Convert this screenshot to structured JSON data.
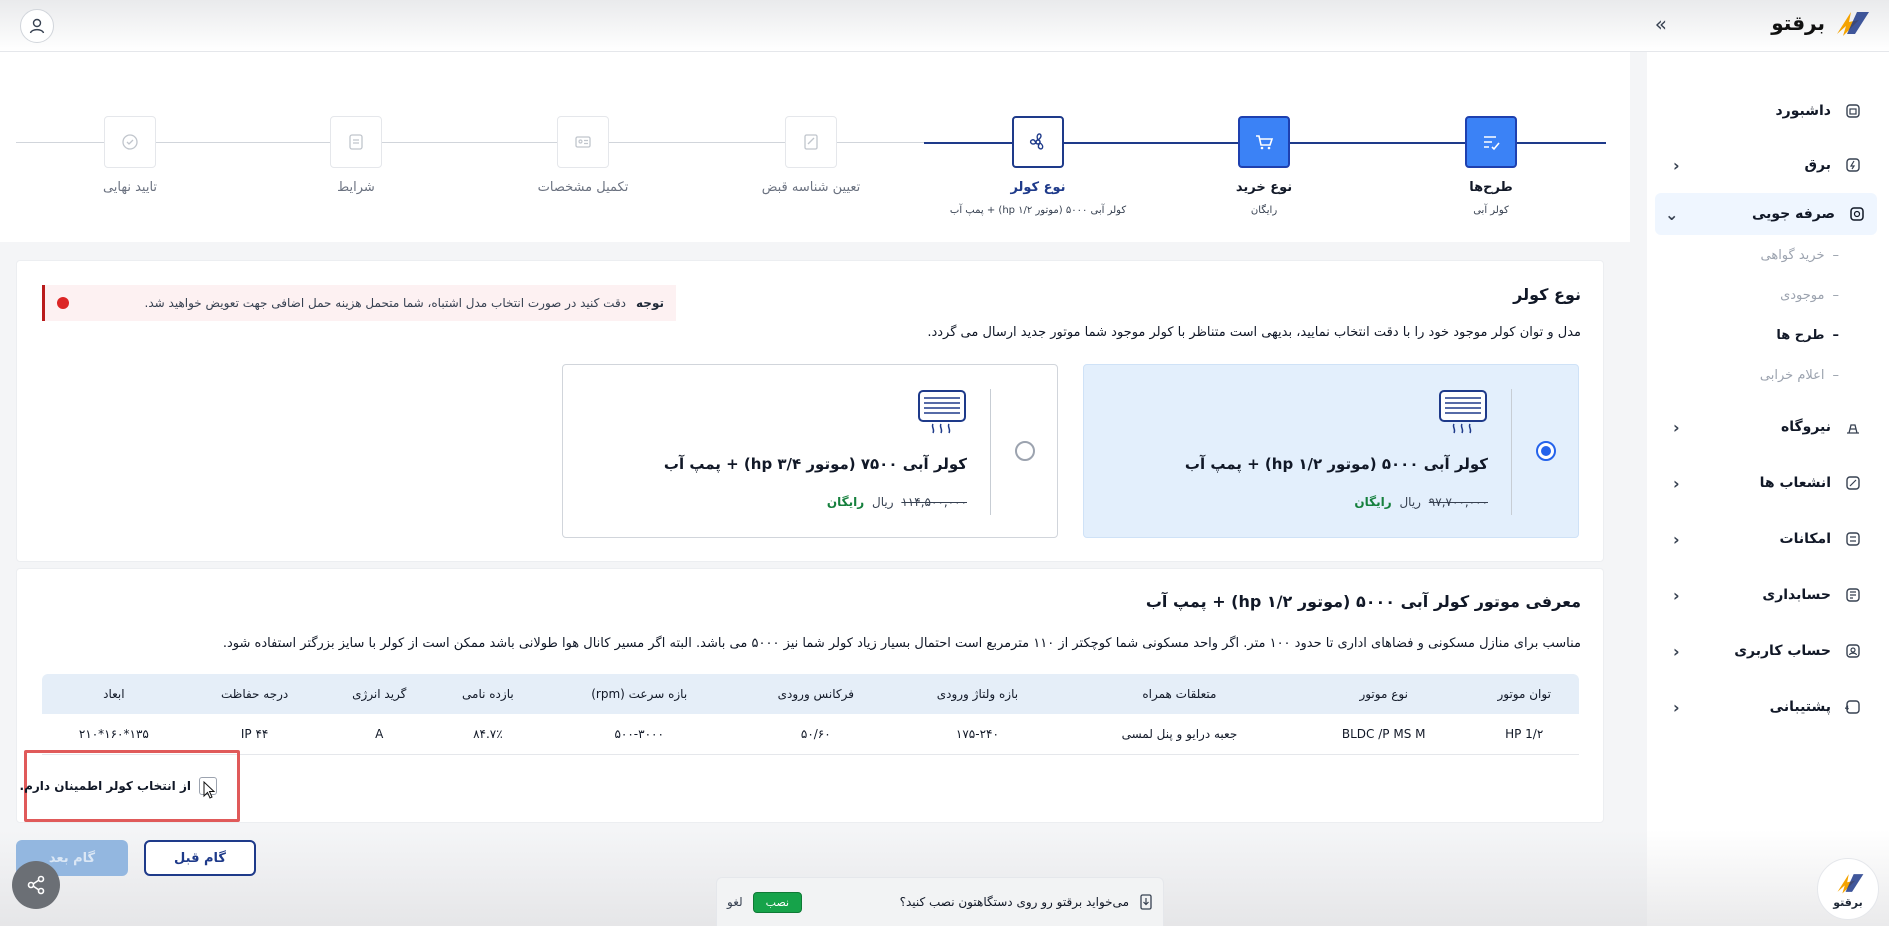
{
  "app": {
    "brand": "برقتو"
  },
  "sidebar": {
    "items": [
      {
        "label": "داشبورد",
        "icon": "dashboard-icon"
      },
      {
        "label": "برق",
        "icon": "electricity-icon"
      },
      {
        "label": "صرفه جویی",
        "icon": "savings-icon"
      },
      {
        "label": "نیروگاه",
        "icon": "power-plant-icon"
      },
      {
        "label": "انشعاب ها",
        "icon": "branch-icon"
      },
      {
        "label": "امکانات",
        "icon": "features-icon"
      },
      {
        "label": "حسابداری",
        "icon": "accounting-icon"
      },
      {
        "label": "حساب کاربری",
        "icon": "account-icon"
      },
      {
        "label": "پشتیبانی",
        "icon": "support-icon"
      }
    ],
    "subitems": [
      {
        "label": "خرید گواهی"
      },
      {
        "label": "موجودی"
      },
      {
        "label": "طرح ها"
      },
      {
        "label": "اعلام خرابی"
      }
    ]
  },
  "stepper": {
    "steps": [
      {
        "title": "طرح‌ها",
        "subtitle": "کولر آبی"
      },
      {
        "title": "نوع خرید",
        "subtitle": "رایگان"
      },
      {
        "title": "نوع کولر",
        "subtitle": "کولر آبی ۵۰۰۰ (موتور hp ۱/۲) + پمپ آب"
      },
      {
        "title": "تعیین شناسه قبض",
        "subtitle": ""
      },
      {
        "title": "تکمیل مشخصات",
        "subtitle": ""
      },
      {
        "title": "شرایط",
        "subtitle": ""
      },
      {
        "title": "تایید نهایی",
        "subtitle": ""
      }
    ]
  },
  "cooler_type": {
    "title": "نوع کولر",
    "description": "مدل و توان کولر موجود خود را با دقت انتخاب نمایید، بدیهی است متناظر با کولر موجود شما موتور جدید ارسال می گردد.",
    "alert": {
      "tag": "توجه",
      "message": "دقت کنید در صورت انتخاب مدل اشتباه، شما متحمل هزینه حمل اضافی جهت تعویض خواهید شد."
    },
    "options": [
      {
        "title": "کولر آبی ۵۰۰۰ (موتور hp ۱/۲) + پمپ آب",
        "old_price": "۹۷,۷۰۰,۰۰۰",
        "currency": "ریال",
        "price_label": "رایگان",
        "selected": true
      },
      {
        "title": "کولر آبی ۷۵۰۰ (موتور hp ۳/۴) + پمپ آب",
        "old_price": "۱۱۴,۵۰۰,۰۰۰",
        "currency": "ریال",
        "price_label": "رایگان",
        "selected": false
      }
    ]
  },
  "motor_intro": {
    "title": "معرفی موتور کولر آبی ۵۰۰۰ (موتور hp ۱/۲) + پمپ آب",
    "description": "مناسب برای منازل مسکونی و فضاهای اداری تا حدود ۱۰۰ متر. اگر واحد مسکونی شما کوچکتر از ۱۱۰ مترمربع است احتمال بسیار زیاد کولر شما نیز ۵۰۰۰ می باشد. البته اگر مسیر کانال هوا طولانی باشد ممکن است از کولر با سایز بزرگتر استفاده شود.",
    "table": {
      "headers": [
        "توان موتور",
        "نوع موتور",
        "متعلقات همراه",
        "بازه ولتاژ ورودی",
        "فرکانس ورودی",
        "بازه سرعت (rpm)",
        "بازده نامی",
        "گرید انرژی",
        "درجه حفاظت",
        "ابعاد"
      ],
      "rows": [
        [
          "1/۲ HP",
          "BLDC /P MS M",
          "جعبه درایو و پنل لمسی",
          "۱۷۵-۲۴۰",
          "۵۰/۶۰",
          "۵۰۰-۳۰۰۰",
          "۸۴.۷٪",
          "A",
          "IP ۴۴",
          "۱۳۵*۱۶۰*۲۱۰"
        ]
      ]
    }
  },
  "confirm": {
    "label": "از انتخاب کولر اطمینان دارم."
  },
  "footer": {
    "prev_label": "گام قبل",
    "next_label": "گام بعد"
  },
  "install_prompt": {
    "text": "می‌خواید برقتو رو روی دستگاهتون نصب کنید؟",
    "install_label": "نصب",
    "cancel_label": "لغو"
  },
  "colors": {
    "primary": "#1e3a8a",
    "accent": "#3b82f6",
    "danger": "#dc2626",
    "success": "#16a34a"
  }
}
